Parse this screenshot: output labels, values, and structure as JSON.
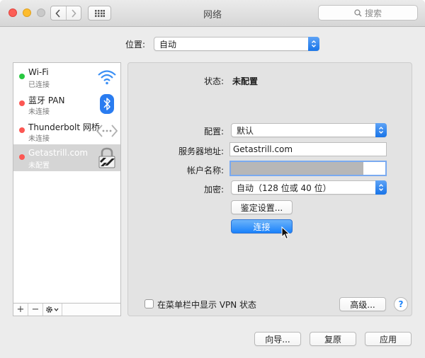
{
  "window": {
    "title": "网络",
    "search_placeholder": "搜索"
  },
  "location": {
    "label": "位置:",
    "value": "自动"
  },
  "services": [
    {
      "name": "Wi-Fi",
      "status": "已连接",
      "status_color": "#28c840",
      "icon": "wifi-icon"
    },
    {
      "name": "蓝牙 PAN",
      "status": "未连接",
      "status_color": "#fc5753",
      "icon": "bluetooth-icon"
    },
    {
      "name": "Thunderbolt 网桥",
      "status": "未连接",
      "status_color": "#fc5753",
      "icon": "thunderbolt-bridge-icon"
    },
    {
      "name": "Getastrill.com",
      "status": "未配置",
      "status_color": "#fc5753",
      "icon": "vpn-lock-icon",
      "selected": true
    }
  ],
  "sidebar_tools": {
    "add": "+",
    "remove": "−"
  },
  "detail": {
    "status_label": "状态:",
    "status_value": "未配置",
    "config_label": "配置:",
    "config_value": "默认",
    "server_label": "服务器地址:",
    "server_value": "Getastrill.com",
    "account_label": "帐户名称:",
    "account_value": "",
    "encryption_label": "加密:",
    "encryption_value": "自动（128 位或 40 位）",
    "auth_button": "鉴定设置...",
    "connect_button": "连接",
    "show_vpn_status": "在菜单栏中显示 VPN 状态",
    "advanced_button": "高级...",
    "help": "?"
  },
  "footer": {
    "assist": "向导...",
    "revert": "复原",
    "apply": "应用"
  },
  "colors": {
    "accent": "#1a82fb",
    "selected_row": "#d5d5d5"
  }
}
